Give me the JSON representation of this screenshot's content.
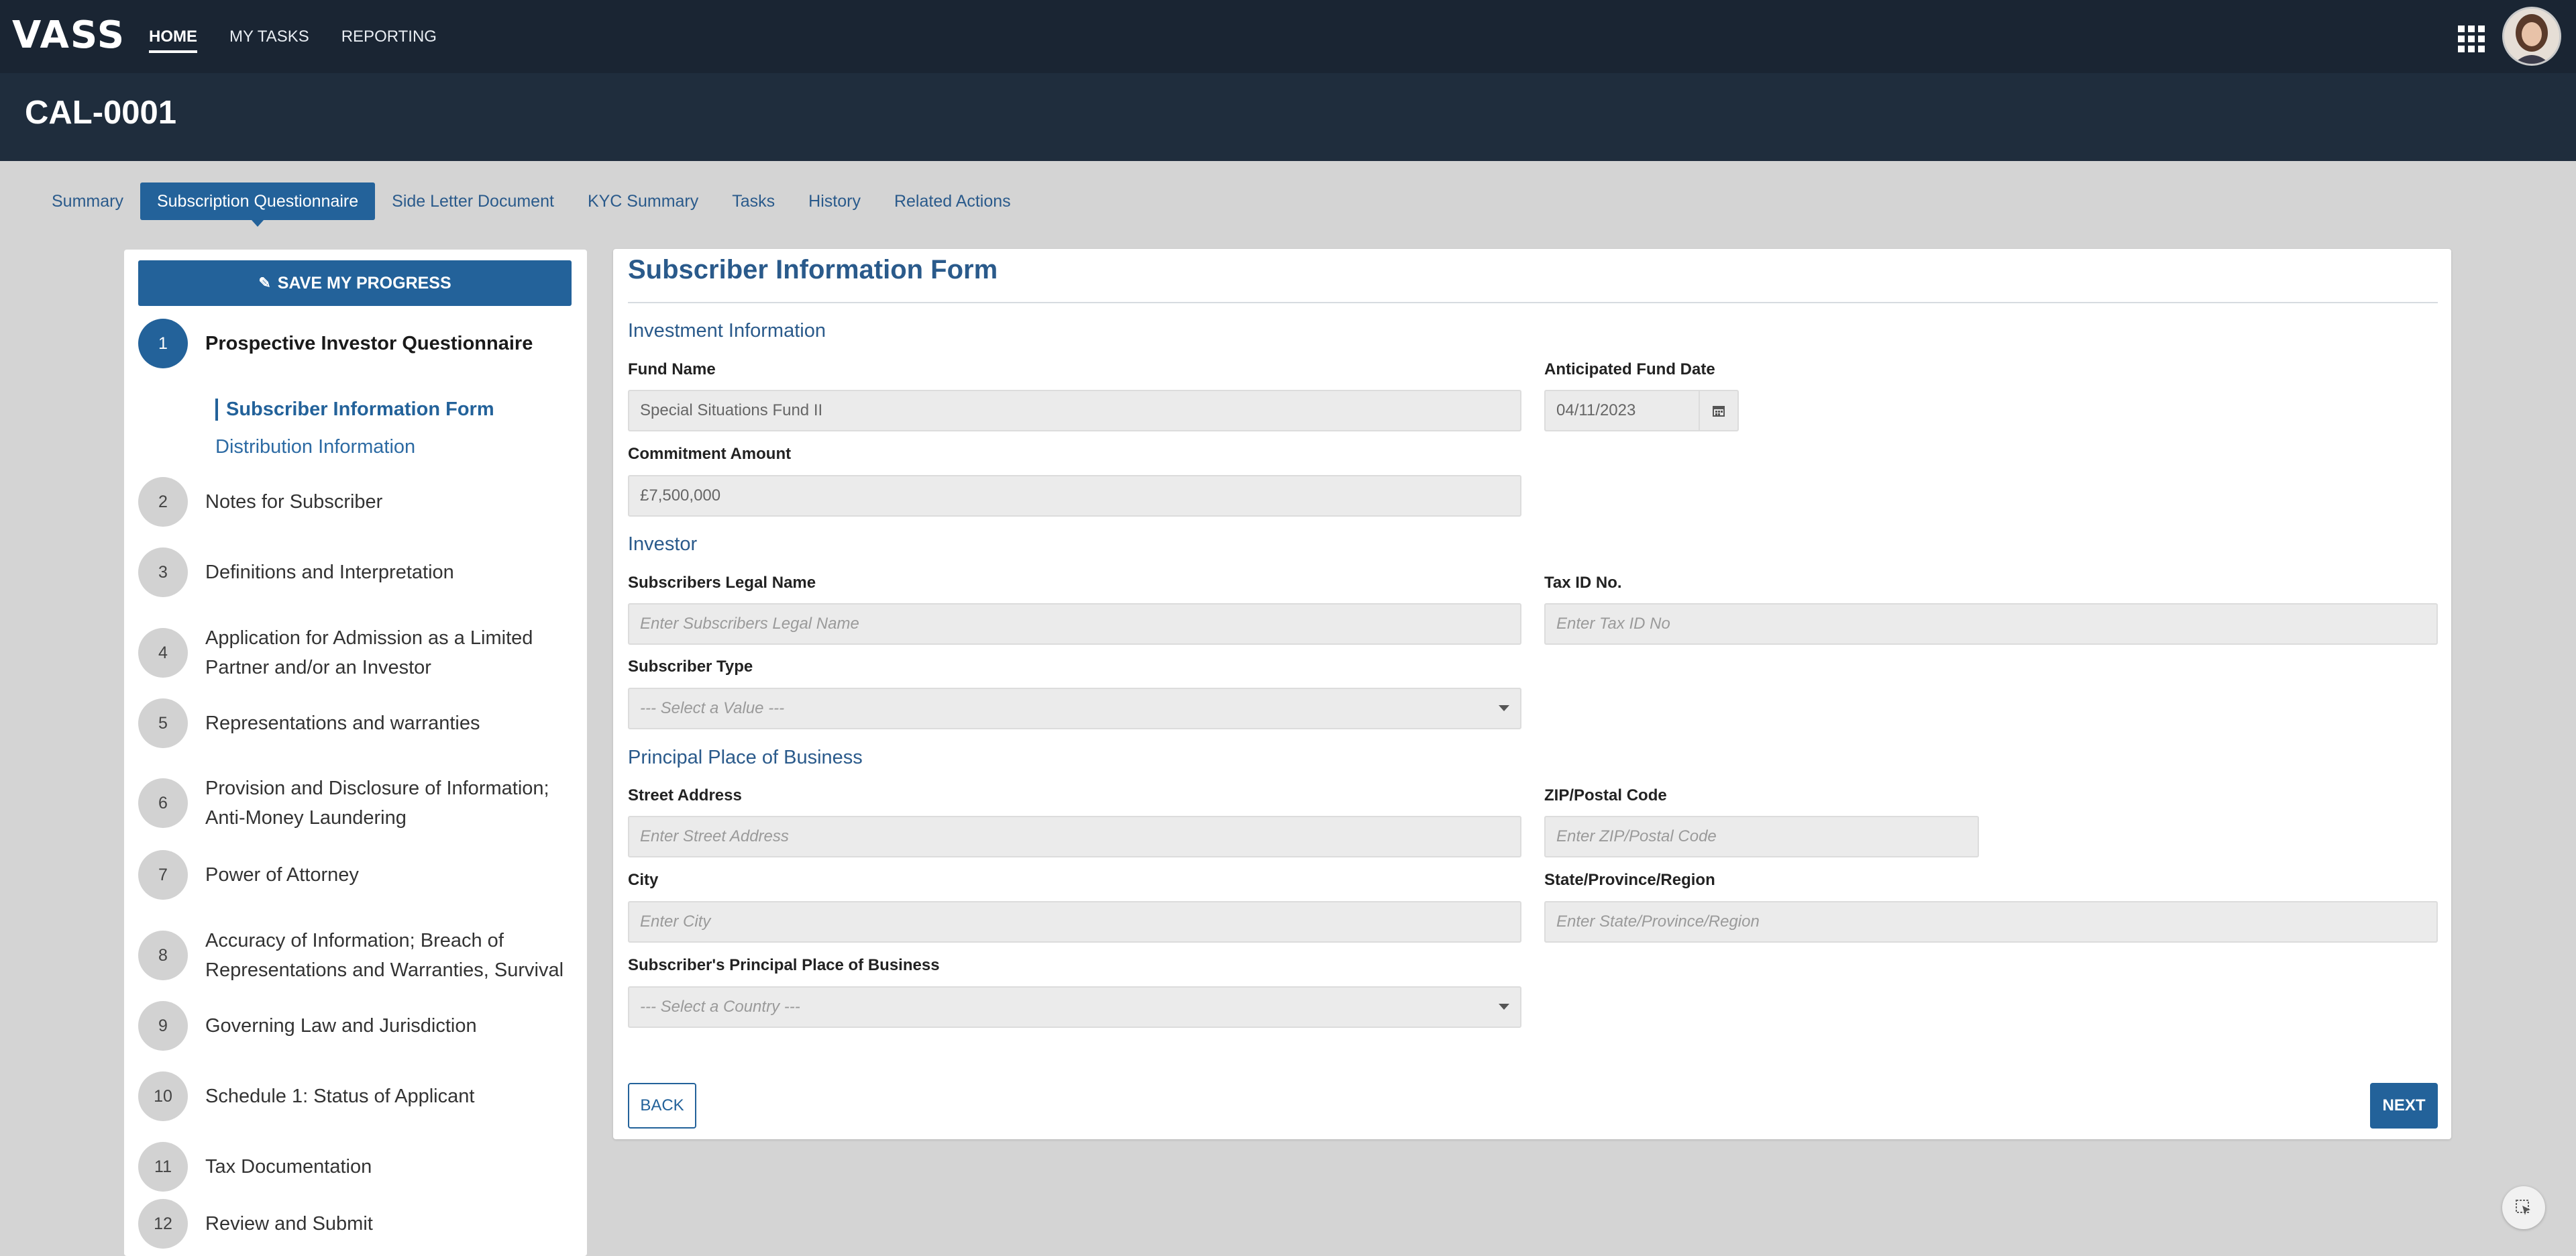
{
  "brand": {
    "logo_text": "VASS"
  },
  "topnav": {
    "items": [
      {
        "label": "HOME"
      },
      {
        "label": "MY TASKS"
      },
      {
        "label": "REPORTING"
      }
    ]
  },
  "header": {
    "title": "CAL-0001"
  },
  "tabs": [
    {
      "label": "Summary"
    },
    {
      "label": "Subscription Questionnaire"
    },
    {
      "label": "Side Letter Document"
    },
    {
      "label": "KYC Summary"
    },
    {
      "label": "Tasks"
    },
    {
      "label": "History"
    },
    {
      "label": "Related Actions"
    }
  ],
  "sidebar": {
    "save_label": "SAVE MY PROGRESS",
    "steps": [
      {
        "num": "1",
        "label": "Prospective Investor Questionnaire"
      },
      {
        "num": "2",
        "label": "Notes for Subscriber"
      },
      {
        "num": "3",
        "label": "Definitions and Interpretation"
      },
      {
        "num": "4",
        "label": "Application for Admission as a Limited Partner and/or an Investor"
      },
      {
        "num": "5",
        "label": "Representations and warranties"
      },
      {
        "num": "6",
        "label": "Provision and Disclosure of Information; Anti-Money Laundering"
      },
      {
        "num": "7",
        "label": "Power of Attorney"
      },
      {
        "num": "8",
        "label": "Accuracy of Information; Breach of Representations and Warranties, Survival"
      },
      {
        "num": "9",
        "label": "Governing Law and Jurisdiction"
      },
      {
        "num": "10",
        "label": "Schedule 1: Status of Applicant"
      },
      {
        "num": "11",
        "label": "Tax Documentation"
      },
      {
        "num": "12",
        "label": "Review and Submit"
      }
    ],
    "substeps": [
      {
        "label": "Subscriber Information Form"
      },
      {
        "label": "Distribution Information"
      }
    ]
  },
  "form": {
    "title": "Subscriber Information Form",
    "sections": {
      "investment": "Investment Information",
      "investor": "Investor",
      "principal": "Principal Place of Business"
    },
    "fields": {
      "fund_name": {
        "label": "Fund Name",
        "value": "Special Situations Fund II"
      },
      "fund_date": {
        "label": "Anticipated Fund Date",
        "value": "04/11/2023"
      },
      "commitment": {
        "label": "Commitment Amount",
        "value": "£7,500,000"
      },
      "legal_name": {
        "label": "Subscribers Legal Name",
        "placeholder": "Enter Subscribers Legal Name"
      },
      "tax_id": {
        "label": "Tax ID No.",
        "placeholder": "Enter Tax ID No"
      },
      "subscriber_type": {
        "label": "Subscriber Type",
        "placeholder": "--- Select a Value ---"
      },
      "street": {
        "label": "Street Address",
        "placeholder": "Enter Street Address"
      },
      "zip": {
        "label": "ZIP/Postal Code",
        "placeholder": "Enter ZIP/Postal Code"
      },
      "city": {
        "label": "City",
        "placeholder": "Enter City"
      },
      "state": {
        "label": "State/Province/Region",
        "placeholder": "Enter State/Province/Region"
      },
      "country": {
        "label": "Subscriber's Principal Place of Business",
        "placeholder": "--- Select a Country ---"
      }
    },
    "back_label": "BACK",
    "next_label": "NEXT"
  },
  "colors": {
    "primary": "#23629a",
    "topbar": "#1a2533",
    "titlebar": "#1f2d3d"
  },
  "icons": [
    "edit-icon",
    "calendar-icon",
    "apps-grid-icon",
    "help-cursor-icon",
    "chevron-down-icon"
  ]
}
